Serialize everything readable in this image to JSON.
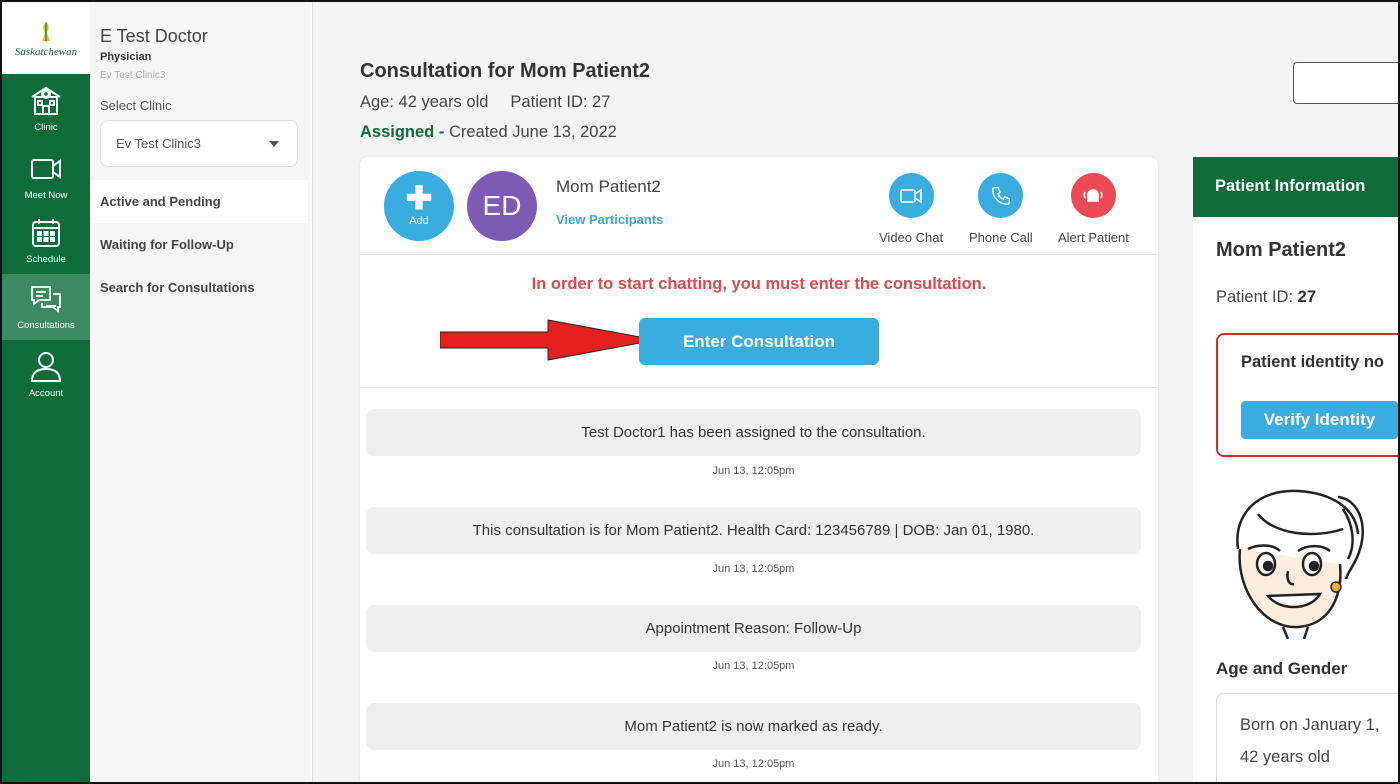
{
  "rail": {
    "logo_text": "Saskatchewan",
    "items": [
      {
        "label": "Clinic",
        "icon": "clinic-icon"
      },
      {
        "label": "Meet Now",
        "icon": "video-camera-icon"
      },
      {
        "label": "Schedule",
        "icon": "calendar-icon"
      },
      {
        "label": "Consultations",
        "icon": "chat-bubbles-icon",
        "active": true
      },
      {
        "label": "Account",
        "icon": "user-icon"
      }
    ]
  },
  "sidebar": {
    "doctor_name": "E Test Doctor",
    "doctor_role": "Physician",
    "doctor_clinic": "Ev Test Clinic3",
    "select_label": "Select Clinic",
    "selected_clinic": "Ev Test Clinic3",
    "nav": [
      {
        "label": "Active and Pending",
        "active": true
      },
      {
        "label": "Waiting for Follow-Up"
      },
      {
        "label": "Search for Consultations"
      }
    ]
  },
  "header": {
    "title": "Consultation for Mom Patient2",
    "age": "Age: 42 years old",
    "patient_id": "Patient ID: 27",
    "status": "Assigned",
    "status_sep": " - ",
    "created": "Created June 13, 2022"
  },
  "consult": {
    "add_label": "Add",
    "avatar_initials": "ED",
    "patient_name": "Mom Patient2",
    "view_participants": "View Participants",
    "actions": [
      {
        "label": "Video Chat",
        "icon": "video-camera-icon",
        "color": "#3aade0"
      },
      {
        "label": "Phone Call",
        "icon": "phone-icon",
        "color": "#3aade0"
      },
      {
        "label": "Alert Patient",
        "icon": "bell-alert-icon",
        "color": "#ee4a55"
      }
    ],
    "warning": "In order to start chatting, you must enter the consultation.",
    "enter_label": "Enter Consultation",
    "messages": [
      {
        "text": "Test Doctor1 has been assigned to the consultation.",
        "time": "Jun 13, 12:05pm"
      },
      {
        "text": "This consultation is for Mom Patient2. Health Card: 123456789 | DOB: Jan 01, 1980.",
        "time": "Jun 13, 12:05pm"
      },
      {
        "text": "Appointment Reason: Follow-Up",
        "time": "Jun 13, 12:05pm"
      },
      {
        "text": "Mom Patient2 is now marked as ready.",
        "time": "Jun 13, 12:05pm"
      }
    ]
  },
  "patient_info": {
    "heading": "Patient Information",
    "name": "Mom Patient2",
    "id_label": "Patient ID:",
    "id_value": "27",
    "identity_text": "Patient identity no",
    "verify_label": "Verify Identity",
    "age_gender_label": "Age and Gender",
    "born": "Born on January 1,",
    "age": "42 years old"
  },
  "colors": {
    "brand_green": "#0e6b3a",
    "accent_blue": "#3aade0",
    "alert_red": "#e04a4a",
    "avatar_purple": "#7d5bb4"
  }
}
